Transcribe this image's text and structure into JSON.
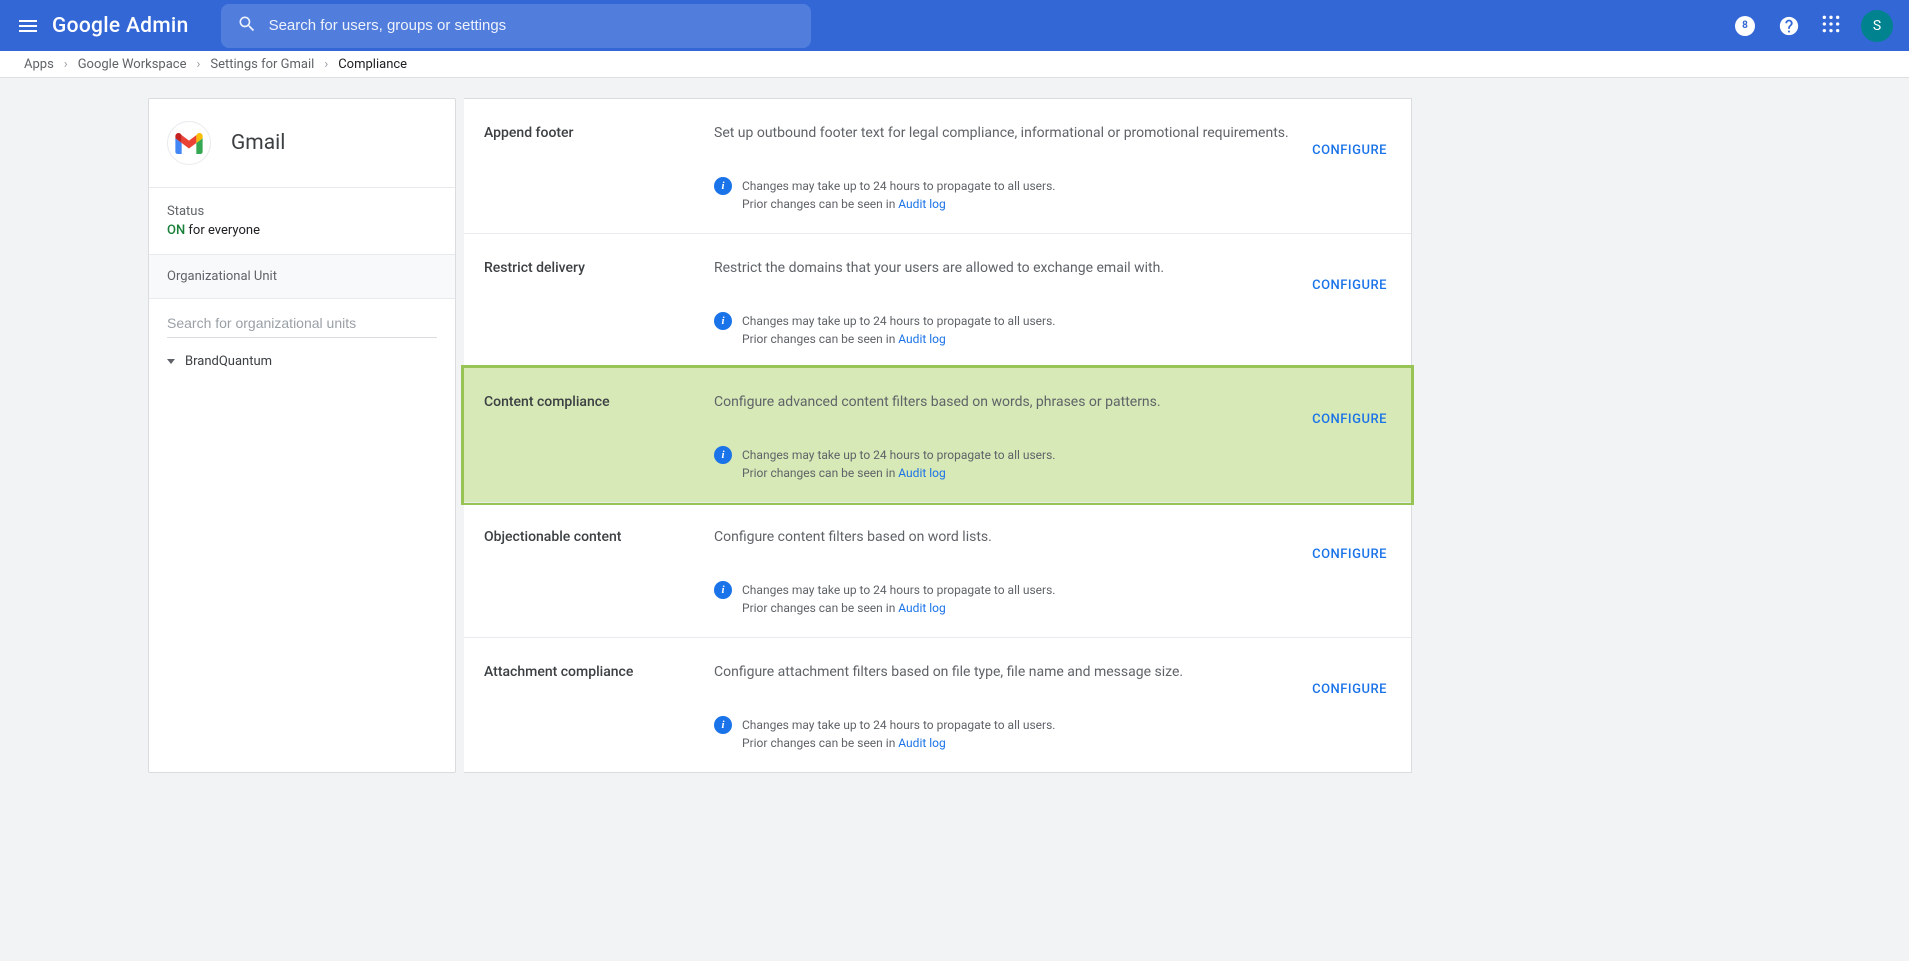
{
  "header": {
    "logo": "Google Admin",
    "search_placeholder": "Search for users, groups or settings",
    "avatar_letter": "S",
    "badge_char": "8"
  },
  "breadcrumb": {
    "items": [
      "Apps",
      "Google Workspace",
      "Settings for Gmail"
    ],
    "current": "Compliance"
  },
  "sidebar": {
    "title": "Gmail",
    "status_label": "Status",
    "status_on": "ON",
    "status_text": " for everyone",
    "ou_header": "Organizational Unit",
    "ou_search_placeholder": "Search for organizational units",
    "ou_items": [
      "BrandQuantum"
    ]
  },
  "common": {
    "configure": "CONFIGURE",
    "info_line1": "Changes may take up to 24 hours to propagate to all users.",
    "info_line2_prefix": "Prior changes can be seen in ",
    "audit_log": "Audit log"
  },
  "sections": [
    {
      "title": "Append footer",
      "desc": "Set up outbound footer text for legal compliance, informational or promotional requirements.",
      "highlighted": false
    },
    {
      "title": "Restrict delivery",
      "desc": "Restrict the domains that your users are allowed to exchange email with.",
      "highlighted": false
    },
    {
      "title": "Content compliance",
      "desc": "Configure advanced content filters based on words, phrases or patterns.",
      "highlighted": true
    },
    {
      "title": "Objectionable content",
      "desc": "Configure content filters based on word lists.",
      "highlighted": false
    },
    {
      "title": "Attachment compliance",
      "desc": "Configure attachment filters based on file type, file name and message size.",
      "highlighted": false
    }
  ]
}
